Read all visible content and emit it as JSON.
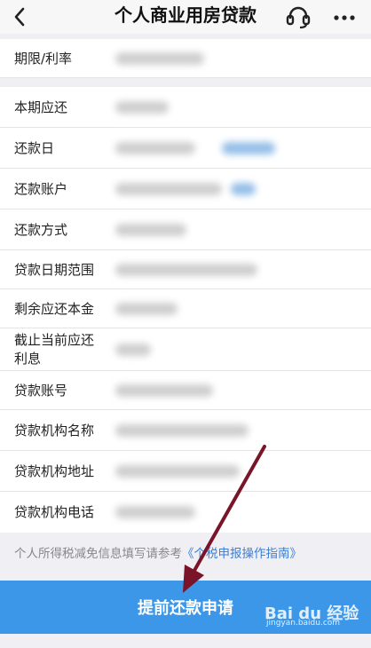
{
  "header": {
    "title": "个人商业用房贷款",
    "back_icon": "chevron-left-icon",
    "service_icon": "headset-icon",
    "more_icon": "more-dots-icon"
  },
  "section1": [
    {
      "label": "期限/利率"
    }
  ],
  "section2": [
    {
      "label": "本期应还"
    },
    {
      "label": "还款日"
    },
    {
      "label": "还款账户"
    },
    {
      "label": "还款方式"
    },
    {
      "label": "贷款日期范围"
    },
    {
      "label": "剩余应还本金"
    },
    {
      "label": "截止当前应还利息"
    },
    {
      "label": "贷款账号"
    },
    {
      "label": "贷款机构名称"
    },
    {
      "label": "贷款机构地址"
    },
    {
      "label": "贷款机构电话"
    }
  ],
  "tip": {
    "text": "个人所得税减免信息填写请参考",
    "link": "《个税申报操作指南》"
  },
  "apply_button": "提前还款申请",
  "watermark": {
    "main": "Bai du 经验",
    "sub": "jingyan.baidu.com"
  },
  "colors": {
    "accent": "#3d97e8",
    "link": "#3a7fd8",
    "annotation_arrow": "#7a1428"
  }
}
